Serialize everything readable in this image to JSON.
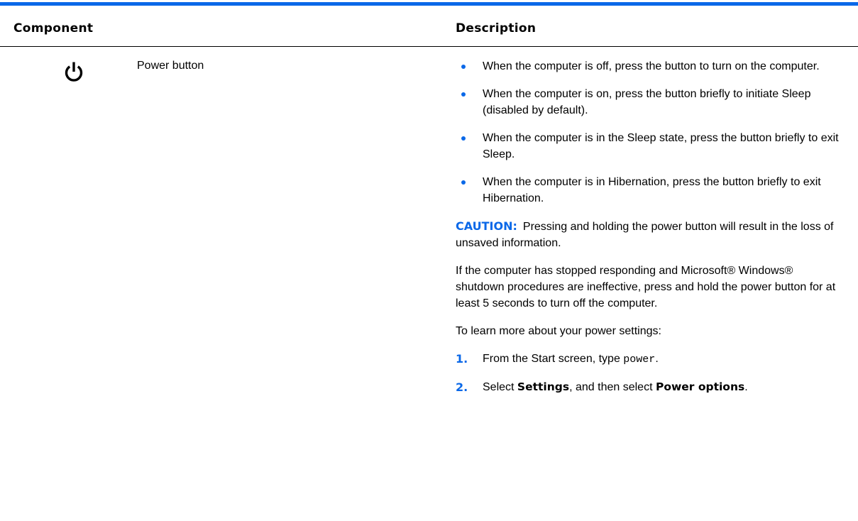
{
  "colors": {
    "accent": "#0a68e8",
    "text": "#000000",
    "background": "#ffffff"
  },
  "table": {
    "headers": {
      "component": "Component",
      "description": "Description"
    },
    "row": {
      "icon": "power-icon",
      "component_name": "Power button",
      "bullets": [
        "When the computer is off, press the button to turn on the computer.",
        "When the computer is on, press the button briefly to initiate Sleep (disabled by default).",
        "When the computer is in the Sleep state, press the button briefly to exit Sleep.",
        "When the computer is in Hibernation, press the button briefly to exit Hibernation."
      ],
      "caution": {
        "label": "CAUTION:",
        "text": "Pressing and holding the power button will result in the loss of unsaved information."
      },
      "paragraph": "If the computer has stopped responding and Microsoft® Windows® shutdown procedures are ineffective, press and hold the power button for at least 5 seconds to turn off the computer.",
      "intro": "To learn more about your power settings:",
      "steps": [
        {
          "num": "1.",
          "text_before": "From the Start screen, type ",
          "code": "power",
          "text_after": "."
        },
        {
          "num": "2.",
          "text_before": "Select ",
          "bold1": "Settings",
          "text_middle": ", and then select ",
          "bold2": "Power options",
          "text_after": "."
        }
      ]
    }
  }
}
